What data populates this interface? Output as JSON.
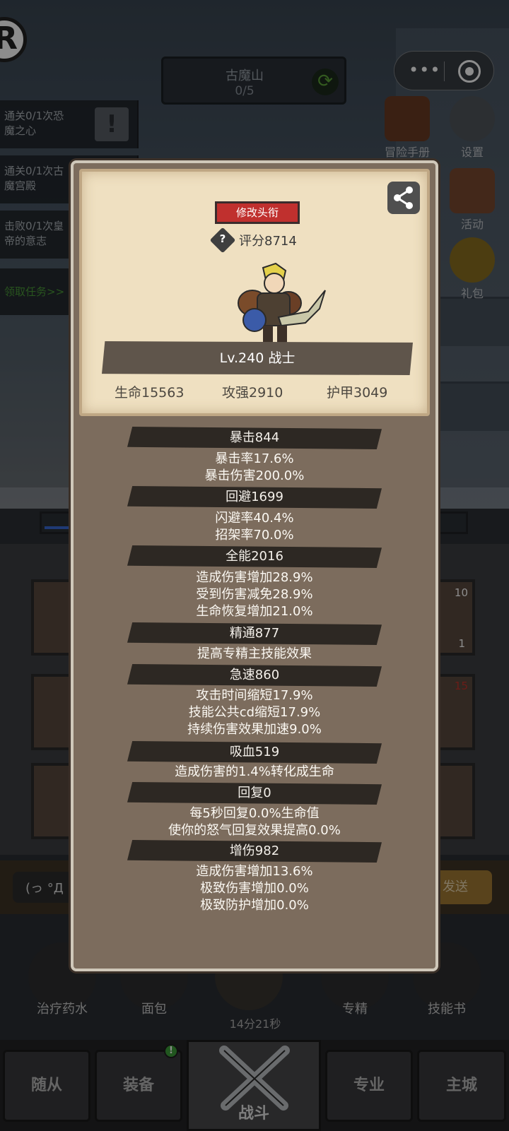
{
  "zone": {
    "name": "古魔山",
    "progress": "0/5"
  },
  "quests": [
    {
      "text_line1": "通关0/1次恐",
      "text_line2": "魔之心"
    },
    {
      "text_line1": "通关0/1次古",
      "text_line2": "魔宫殿"
    },
    {
      "text_line1": "击败0/1次皇",
      "text_line2": "帝的意志"
    }
  ],
  "quest_claim": "领取任务>>",
  "side_buttons": {
    "handbook": "冒险手册",
    "settings": "设置",
    "activity": "活动",
    "gift": "礼包"
  },
  "chat": {
    "input_text": "(っ °Д",
    "send_label": "发送"
  },
  "items": [
    {
      "label": "治疗药水"
    },
    {
      "label": "面包"
    },
    {
      "label": "专精"
    },
    {
      "label": "技能书"
    }
  ],
  "timer": "14分21秒",
  "slot_counts": {
    "top_right": "10",
    "mid_right": "1",
    "lower_right": "15"
  },
  "nav": {
    "tabs": [
      "随从",
      "装备",
      "战斗",
      "专业",
      "主城"
    ],
    "badge": "!"
  },
  "profile": {
    "edit_title_label": "修改头衔",
    "score_help": "?",
    "score": "评分8714",
    "level_class": "Lv.240 战士",
    "hp": "生命15563",
    "attack": "攻强2910",
    "armor": "护甲3049"
  },
  "attributes": [
    {
      "header": "暴击844",
      "lines": [
        "暴击率17.6%",
        "暴击伤害200.0%"
      ]
    },
    {
      "header": "回避1699",
      "lines": [
        "闪避率40.4%",
        "招架率70.0%"
      ]
    },
    {
      "header": "全能2016",
      "lines": [
        "造成伤害增加28.9%",
        "受到伤害减免28.9%",
        "生命恢复增加21.0%"
      ]
    },
    {
      "header": "精通877",
      "lines": [
        "提高专精主技能效果"
      ]
    },
    {
      "header": "急速860",
      "lines": [
        "攻击时间缩短17.9%",
        "技能公共cd缩短17.9%",
        "持续伤害效果加速9.0%"
      ]
    },
    {
      "header": "吸血519",
      "lines": [
        "造成伤害的1.4%转化成生命"
      ]
    },
    {
      "header": "回复0",
      "lines": [
        "每5秒回复0.0%生命值",
        "使你的怒气回复效果提高0.0%"
      ]
    },
    {
      "header": "增伤982",
      "lines": [
        "造成伤害增加13.6%",
        "极致伤害增加0.0%",
        "极致防护增加0.0%"
      ]
    }
  ],
  "colors": {
    "title_button": "#c0302e",
    "modal_bg": "#7c6c5d",
    "card_bg": "#efe0c1",
    "attr_header": "#2d2823"
  }
}
